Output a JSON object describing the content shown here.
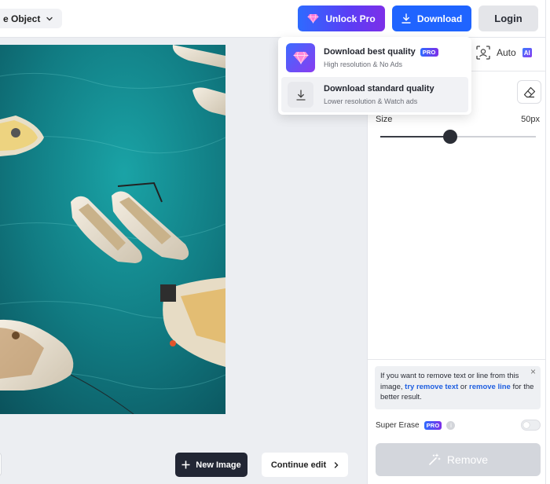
{
  "toolbar": {
    "tool_select_label": "e Object",
    "unlock_label": "Unlock Pro",
    "download_label": "Download",
    "login_label": "Login"
  },
  "download_menu": {
    "best": {
      "title": "Download best quality",
      "badge": "PRO",
      "subtitle": "High resolution & No Ads"
    },
    "standard": {
      "title": "Download standard quality",
      "subtitle": "Lower resolution & Watch ads"
    }
  },
  "panel": {
    "auto_label": "Auto",
    "ai_badge": "AI",
    "size_label": "Size",
    "size_value": "50px",
    "size_fraction": 0.45,
    "info": {
      "text_1": "If you want to remove text or line from this image,",
      "link_1": "try remove text",
      "text_2": "or",
      "link_2": "remove line",
      "text_3": "for the better result.",
      "close": "×"
    },
    "super_erase_label": "Super Erase",
    "super_erase_badge": "PRO",
    "info_dot": "i",
    "remove_label": "Remove"
  },
  "bottom": {
    "new_image_label": "New Image",
    "continue_label": "Continue edit"
  },
  "colors": {
    "accent_blue": "#1f64ff",
    "pro_gradient_start": "#2e6bff",
    "pro_gradient_end": "#7d2fe8",
    "link_blue": "#1f5fe0"
  },
  "icons": {
    "tool_chevron": "chevron-down-icon",
    "unlock": "diamond-icon",
    "download": "download-icon",
    "auto": "face-scan-icon",
    "eraser": "eraser-icon",
    "remove": "magic-wand-icon",
    "new_image": "plus-icon",
    "continue": "chevron-right-icon"
  }
}
